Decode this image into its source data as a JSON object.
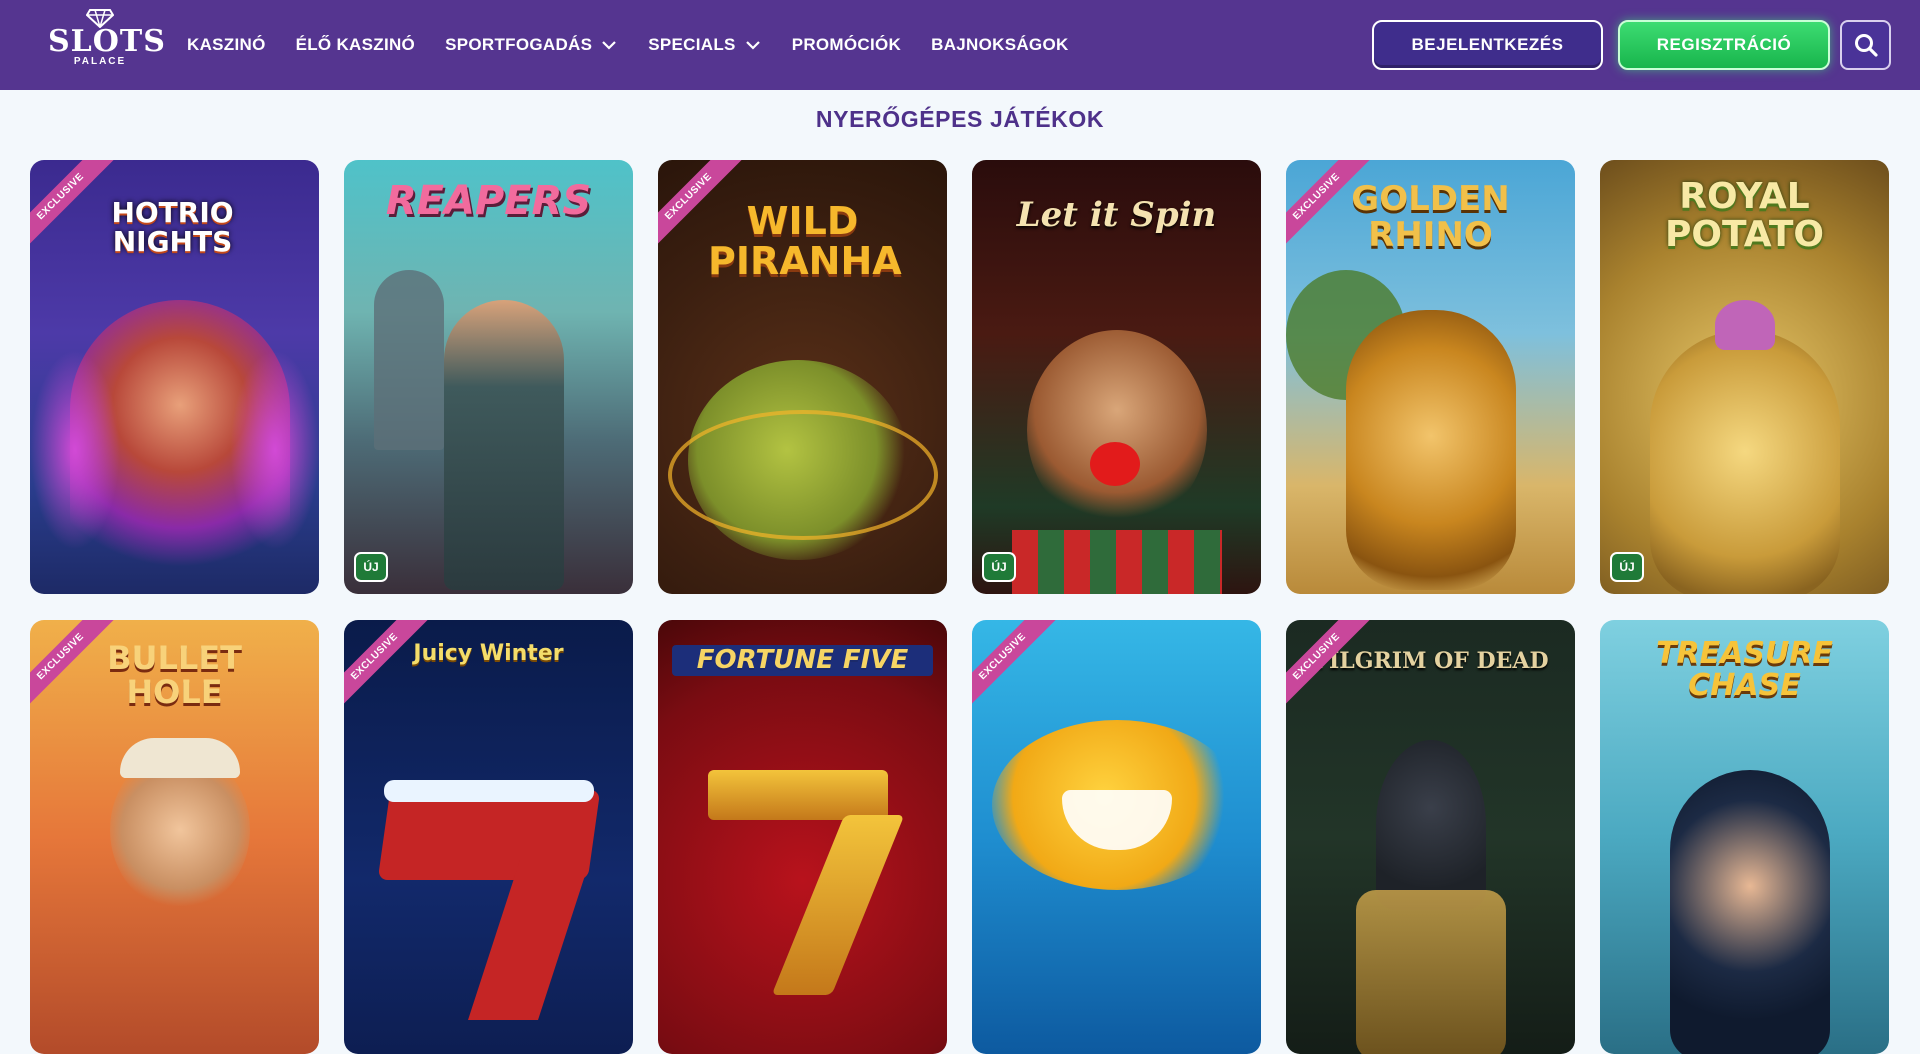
{
  "brand": {
    "name": "SLOTS",
    "sub": "PALACE"
  },
  "nav": [
    {
      "label": "KASZINÓ",
      "dropdown": false
    },
    {
      "label": "ÉLŐ KASZINÓ",
      "dropdown": false
    },
    {
      "label": "SPORTFOGADÁS",
      "dropdown": true
    },
    {
      "label": "SPECIALS",
      "dropdown": true
    },
    {
      "label": "PROMÓCIÓK",
      "dropdown": false
    },
    {
      "label": "BAJNOKSÁGOK",
      "dropdown": false
    }
  ],
  "auth": {
    "login_label": "BEJELENTKEZÉS",
    "register_label": "REGISZTRÁCIÓ"
  },
  "section_title": "NYERŐGÉPES JÁTÉKOK",
  "badges": {
    "exclusive": "EXCLUSIVE",
    "new": "ÚJ"
  },
  "games": [
    {
      "title": "HOTRIO NIGHTS",
      "exclusive": true,
      "new": false
    },
    {
      "title": "REAPERS",
      "exclusive": false,
      "new": true
    },
    {
      "title": "WILD PIRANHA",
      "exclusive": true,
      "new": false
    },
    {
      "title": "Let it Spin",
      "exclusive": false,
      "new": true
    },
    {
      "title": "GOLDEN RHINO",
      "exclusive": true,
      "new": false
    },
    {
      "title": "ROYAL POTATO",
      "exclusive": false,
      "new": true
    },
    {
      "title": "BULLET HOLE",
      "exclusive": true,
      "new": false
    },
    {
      "title": "Juicy Winter",
      "exclusive": true,
      "new": false
    },
    {
      "title": "FORTUNE FIVE",
      "exclusive": false,
      "new": false
    },
    {
      "title": "",
      "exclusive": true,
      "new": false
    },
    {
      "title": "PILGRIM OF DEAD",
      "exclusive": true,
      "new": false
    },
    {
      "title": "TREASURE CHASE",
      "exclusive": false,
      "new": false
    }
  ],
  "colors": {
    "header_bg": "#553590",
    "accent_green": "#22c55e",
    "title_purple": "#4e318a",
    "badge_pink": "#c9479b"
  }
}
